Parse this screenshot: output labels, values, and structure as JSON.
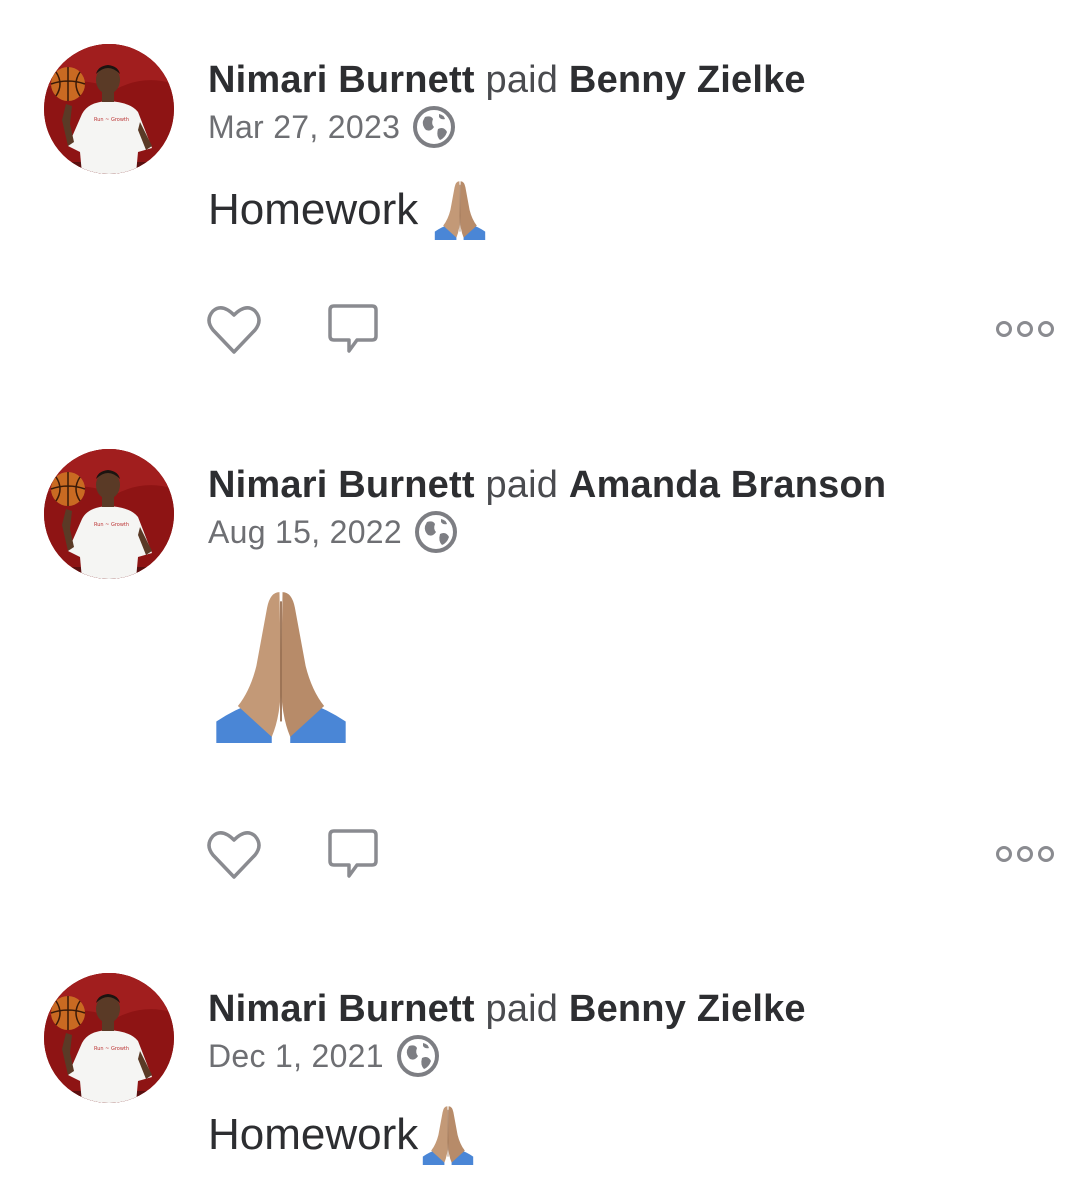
{
  "feed": {
    "posts": [
      {
        "payer": "Nimari Burnett",
        "verb": "paid",
        "payee": "Benny Zielke",
        "date": "Mar 27, 2023",
        "privacy_icon": "globe-icon",
        "note_text": "Homework",
        "note_emoji": "folded-hands-emoji"
      },
      {
        "payer": "Nimari Burnett",
        "verb": "paid",
        "payee": "Amanda Branson",
        "date": "Aug 15, 2022",
        "privacy_icon": "globe-icon",
        "note_text": "",
        "note_emoji": "folded-hands-emoji"
      },
      {
        "payer": "Nimari Burnett",
        "verb": "paid",
        "payee": "Benny Zielke",
        "date": "Dec 1, 2021",
        "privacy_icon": "globe-icon",
        "note_text": "Homework",
        "note_emoji": "folded-hands-emoji"
      }
    ],
    "action_icons": [
      "heart-icon",
      "comment-icon",
      "more-options-icon"
    ],
    "colors": {
      "text": "#2d2e31",
      "muted": "#6e6f73",
      "icon": "#8a8b90",
      "avatar_bg": "#8e1414"
    }
  }
}
